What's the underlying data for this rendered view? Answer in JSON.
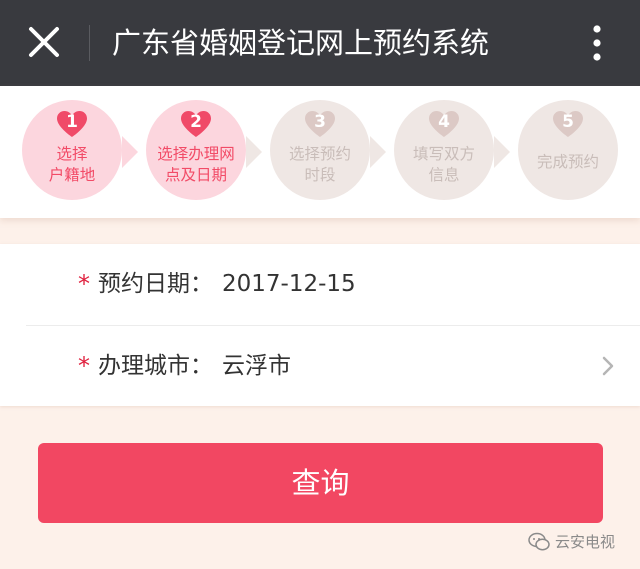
{
  "header": {
    "title": "广东省婚姻登记网上预约系统",
    "background": "#393a3f"
  },
  "steps": [
    {
      "number": "1",
      "label": "选择\n户籍地",
      "state": "completed"
    },
    {
      "number": "2",
      "label": "选择办理网\n点及日期",
      "state": "current"
    },
    {
      "number": "3",
      "label": "选择预约\n时段",
      "state": "pending"
    },
    {
      "number": "4",
      "label": "填写双方\n信息",
      "state": "pending"
    },
    {
      "number": "5",
      "label": "完成预约",
      "state": "pending"
    }
  ],
  "form": {
    "date": {
      "required_mark": "*",
      "label": "预约日期：",
      "value": "2017-12-15"
    },
    "city": {
      "required_mark": "*",
      "label": "办理城市：",
      "value": "云浮市"
    }
  },
  "submit": {
    "label": "查询",
    "color": "#f24762"
  },
  "watermark": {
    "text": "云安电视"
  },
  "colors": {
    "accent": "#f24762",
    "step_active_bg": "#fcd6de",
    "step_inactive_bg": "#efe7e4",
    "page_bg": "#fdf1ea"
  }
}
